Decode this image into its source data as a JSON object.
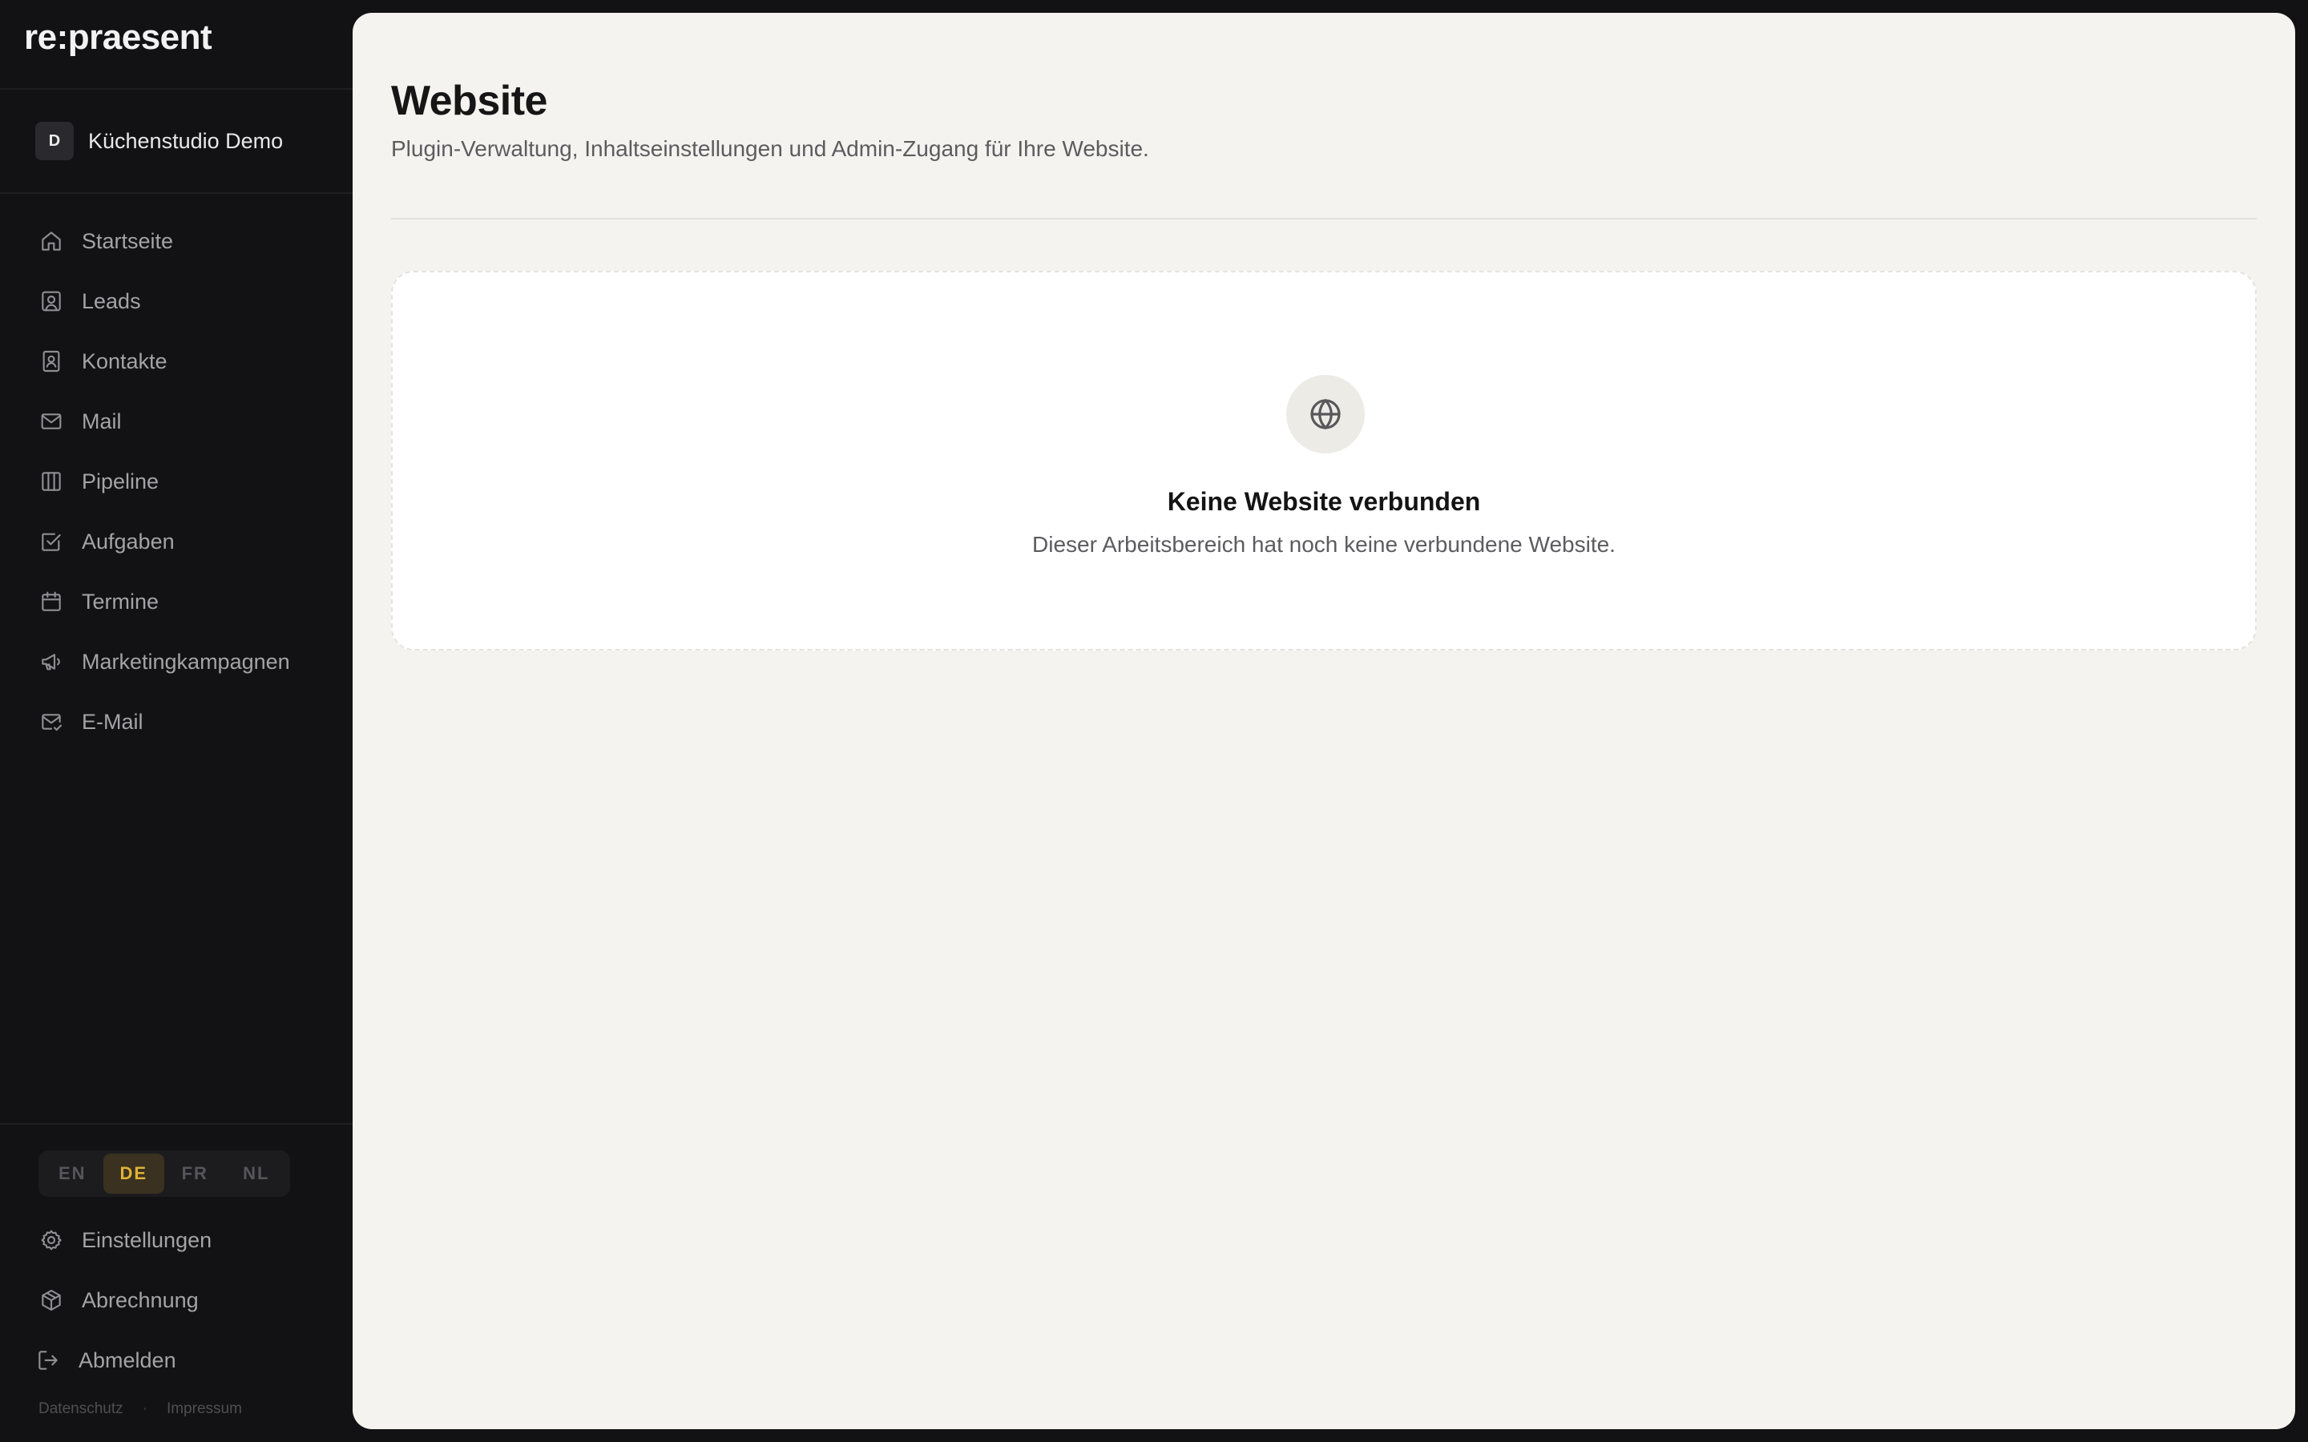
{
  "brand": {
    "logo": "re:praesent"
  },
  "workspace": {
    "initial": "D",
    "name": "Küchenstudio Demo"
  },
  "sidebar": {
    "items": [
      {
        "label": "Startseite",
        "icon": "home-icon"
      },
      {
        "label": "Leads",
        "icon": "user-square-icon"
      },
      {
        "label": "Kontakte",
        "icon": "contact-book-icon"
      },
      {
        "label": "Mail",
        "icon": "mail-icon"
      },
      {
        "label": "Pipeline",
        "icon": "columns-icon"
      },
      {
        "label": "Aufgaben",
        "icon": "checkbox-icon"
      },
      {
        "label": "Termine",
        "icon": "calendar-icon"
      },
      {
        "label": "Marketingkampagnen",
        "icon": "megaphone-icon"
      },
      {
        "label": "E-Mail",
        "icon": "mail-check-icon"
      }
    ],
    "bottom_items": [
      {
        "label": "Einstellungen",
        "icon": "gear-icon"
      },
      {
        "label": "Abrechnung",
        "icon": "package-icon"
      },
      {
        "label": "Abmelden",
        "icon": "logout-icon"
      }
    ]
  },
  "languages": {
    "options": [
      "EN",
      "DE",
      "FR",
      "NL"
    ],
    "selected": "DE"
  },
  "footer": {
    "privacy": "Datenschutz",
    "separator": "·",
    "imprint": "Impressum"
  },
  "page": {
    "title": "Website",
    "subtitle": "Plugin-Verwaltung, Inhaltseinstellungen und Admin-Zugang für Ihre Website."
  },
  "empty_state": {
    "icon": "globe-icon",
    "title": "Keine Website verbunden",
    "text": "Dieser Arbeitsbereich hat noch keine verbundene Website."
  },
  "colors": {
    "sidebar_bg": "#121214",
    "main_bg": "#f4f3ef",
    "accent": "#e0b235"
  }
}
